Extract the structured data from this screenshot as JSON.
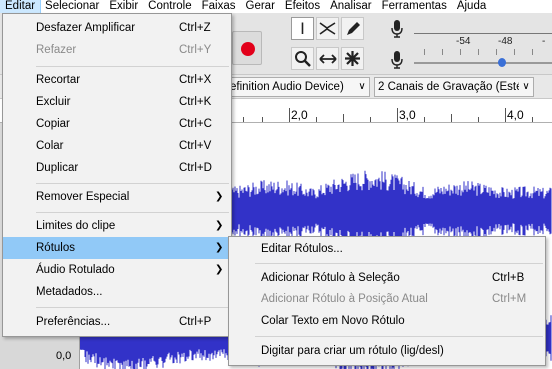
{
  "menubar": {
    "items": [
      "Editar",
      "Selecionar",
      "Exibir",
      "Controle",
      "Faixas",
      "Gerar",
      "Efeitos",
      "Analisar",
      "Ferramentas",
      "Ajuda"
    ],
    "active": "Editar"
  },
  "meter": {
    "scale": [
      "-54",
      "-48",
      "-"
    ]
  },
  "device": {
    "input_device": "efinition Audio Device)",
    "channels": "2 Canais de Gravação (Estér"
  },
  "ruler": {
    "labels": [
      "2,0",
      "3,0",
      "4,0"
    ]
  },
  "track": {
    "scale_label": "0,0"
  },
  "edit_menu": {
    "items": [
      {
        "label": "Desfazer Amplificar",
        "shortcut": "Ctrl+Z",
        "disabled": false
      },
      {
        "label": "Refazer",
        "shortcut": "Ctrl+Y",
        "disabled": true
      },
      {
        "label": "Recortar",
        "shortcut": "Ctrl+X",
        "disabled": false
      },
      {
        "label": "Excluir",
        "shortcut": "Ctrl+K",
        "disabled": false
      },
      {
        "label": "Copiar",
        "shortcut": "Ctrl+C",
        "disabled": false
      },
      {
        "label": "Colar",
        "shortcut": "Ctrl+V",
        "disabled": false
      },
      {
        "label": "Duplicar",
        "shortcut": "Ctrl+D",
        "disabled": false
      },
      {
        "label": "Remover Especial",
        "submenu": true
      },
      {
        "label": "Limites do clipe",
        "submenu": true
      },
      {
        "label": "Rótulos",
        "submenu": true,
        "highlighted": true
      },
      {
        "label": "Áudio Rotulado",
        "submenu": true
      },
      {
        "label": "Metadados..."
      },
      {
        "label": "Preferências...",
        "shortcut": "Ctrl+P"
      }
    ]
  },
  "labels_submenu": {
    "items": [
      {
        "label": "Editar Rótulos...",
        "shortcut": "",
        "disabled": false
      },
      {
        "label": "Adicionar Rótulo à Seleção",
        "shortcut": "Ctrl+B",
        "disabled": false
      },
      {
        "label": "Adicionar Rótulo à Posição Atual",
        "shortcut": "Ctrl+M",
        "disabled": true
      },
      {
        "label": "Colar Texto em Novo Rótulo",
        "shortcut": "",
        "disabled": false
      },
      {
        "label": "Digitar para criar um rótulo (lig/desl)",
        "shortcut": "",
        "disabled": false
      }
    ]
  },
  "colors": {
    "waveform": "#3232c8",
    "record": "#e2001a",
    "highlight": "#91c9f7",
    "menubar_active": "#cce8ff"
  }
}
